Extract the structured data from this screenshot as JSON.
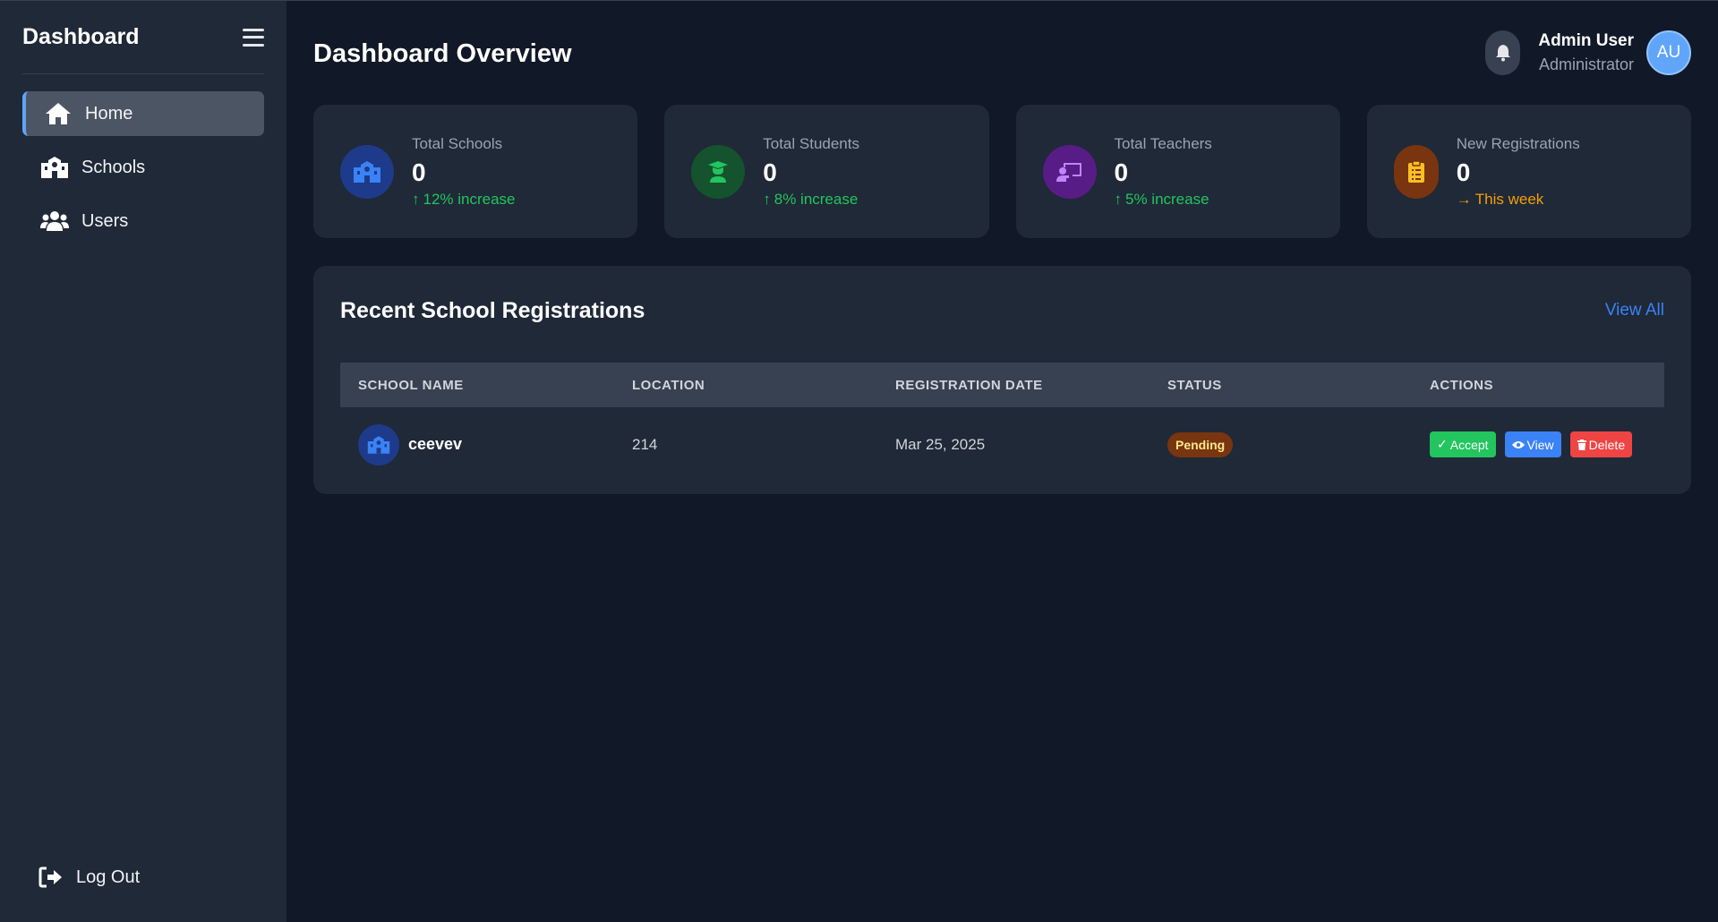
{
  "sidebar": {
    "title": "Dashboard",
    "items": [
      {
        "label": "Home",
        "icon": "home-icon",
        "active": true
      },
      {
        "label": "Schools",
        "icon": "school-icon",
        "active": false
      },
      {
        "label": "Users",
        "icon": "users-icon",
        "active": false
      }
    ],
    "logout_label": "Log Out"
  },
  "header": {
    "title": "Dashboard Overview",
    "user_name": "Admin User",
    "user_role": "Administrator",
    "avatar_initials": "AU"
  },
  "stats": [
    {
      "label": "Total Schools",
      "value": "0",
      "trend": "12% increase",
      "icon": "school-icon",
      "color": "#3b82f6",
      "bg": "#1e3a8a"
    },
    {
      "label": "Total Students",
      "value": "0",
      "trend": "8% increase",
      "icon": "graduate-icon",
      "color": "#22c55e",
      "bg": "#14532d"
    },
    {
      "label": "Total Teachers",
      "value": "0",
      "trend": "5% increase",
      "icon": "teacher-icon",
      "color": "#c084fc",
      "bg": "#581c87"
    },
    {
      "label": "New Registrations",
      "value": "0",
      "trend": "This week",
      "icon": "clipboard-icon",
      "color": "#fbbf24",
      "bg": "#78350f"
    }
  ],
  "recent": {
    "title": "Recent School Registrations",
    "view_all": "View All",
    "columns": [
      "SCHOOL NAME",
      "LOCATION",
      "REGISTRATION DATE",
      "STATUS",
      "ACTIONS"
    ],
    "rows": [
      {
        "name": "ceevev",
        "location": "214",
        "date": "Mar 25, 2025",
        "status": "Pending"
      }
    ],
    "actions": {
      "accept": "Accept",
      "view": "View",
      "delete": "Delete"
    }
  },
  "colors": {
    "accent": "#3b82f6",
    "success": "#22c55e",
    "danger": "#ef4444",
    "warning": "#f59e0b"
  }
}
